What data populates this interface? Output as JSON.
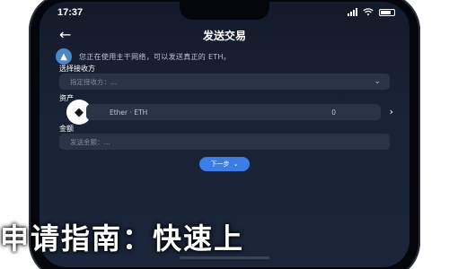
{
  "status_bar": {
    "time": "17:37"
  },
  "nav": {
    "title": "发送交易",
    "back_icon": "arrow-left-icon"
  },
  "warning": {
    "text": "您正在使用主干网络，可以发送真正的 ETH。",
    "icon": "info-icon"
  },
  "form": {
    "network_label": "选择接收方",
    "network_placeholder": "指定接收方：...",
    "asset_label": "资产",
    "asset_name": "Ether · ETH",
    "asset_amount": "0",
    "amount_label": "金额",
    "amount_placeholder": "发送金额：..."
  },
  "next_button": {
    "label": "下一步"
  },
  "banner": {
    "text": "申请指南：快速上"
  },
  "colors": {
    "background": "#1a2336",
    "field": "#2b3447",
    "accent": "#3d7de6",
    "warning_icon": "#4a86c8"
  }
}
